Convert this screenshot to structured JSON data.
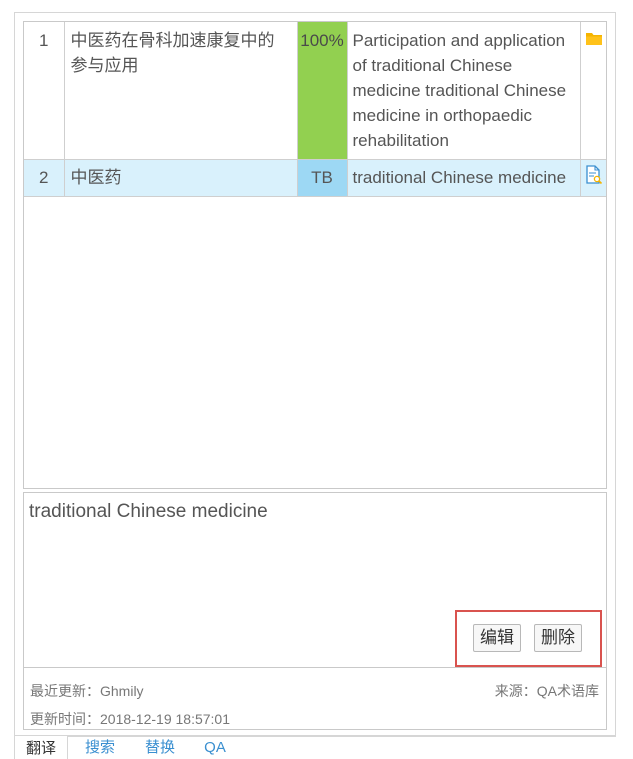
{
  "results": [
    {
      "num": "1",
      "source": "中医药在骨科加速康复中的参与应用",
      "match": "100%",
      "target": "Participation and application of traditional Chinese medicine traditional Chinese medicine in orthopaedic rehabilitation",
      "icon": "folder-icon",
      "match_color": "#92d050"
    },
    {
      "num": "2",
      "source": "中医药",
      "match": "TB",
      "target": "traditional Chinese medicine",
      "icon": "document-search-icon",
      "match_color": "#9dd8f4"
    }
  ],
  "detail": {
    "text": "traditional Chinese medicine",
    "edit_label": "编辑",
    "delete_label": "删除"
  },
  "meta": {
    "updated_by": "最近更新：Ghmily",
    "source": "来源：QA术语库",
    "updated_time": "更新时间：2018-12-19 18:57:01"
  },
  "tabs": {
    "translate": "翻译",
    "search": "搜索",
    "replace": "替换",
    "qa": "QA"
  },
  "colors": {
    "highlight": "#d9534f",
    "selected_row": "#d9f1fc",
    "link": "#3a8fd0",
    "folder": "#f5b400"
  }
}
